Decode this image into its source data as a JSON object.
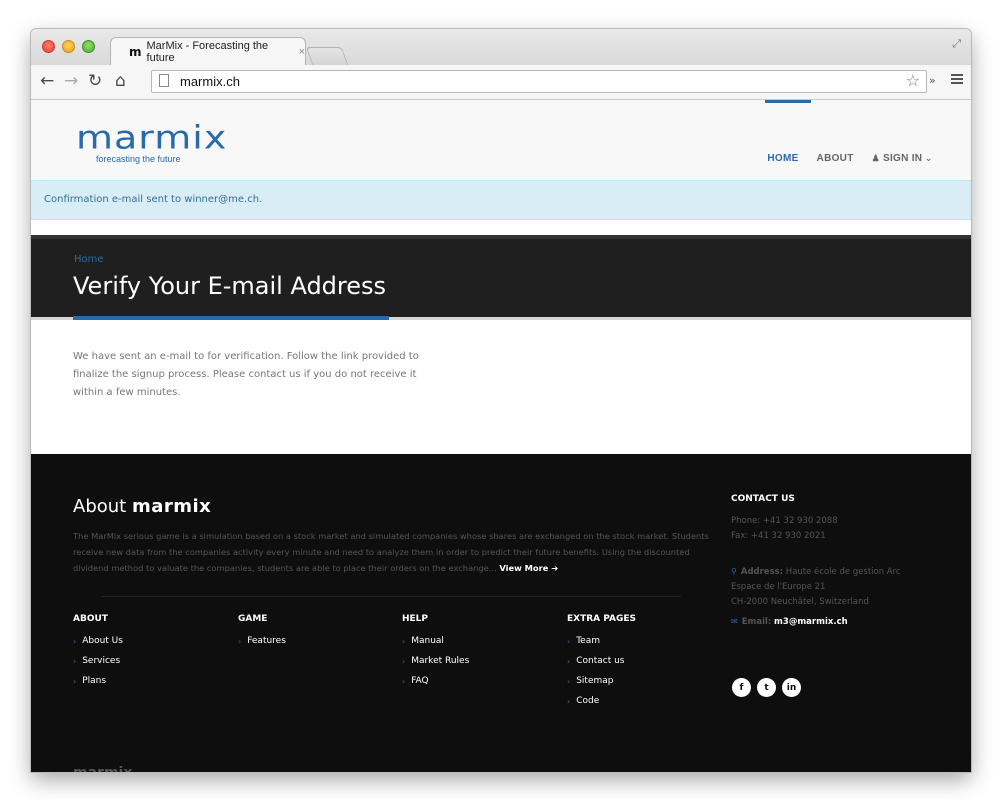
{
  "browser": {
    "tab_title": "MarMix - Forecasting the future",
    "tab_favicon": "m",
    "tab_close": "×",
    "url": "marmix.ch",
    "extensions_label": "»"
  },
  "header": {
    "logo_text": "marmix",
    "logo_tagline": "forecasting the future",
    "nav": {
      "home": "HOME",
      "about": "ABOUT",
      "signin": "SIGN IN",
      "signin_caret": "⌄"
    }
  },
  "alert": {
    "text": "Confirmation e-mail sent to winner@me.ch."
  },
  "title_bar": {
    "breadcrumb": "Home",
    "title": "Verify Your E-mail Address"
  },
  "content": {
    "message": "We have sent an e-mail to for verification. Follow the link provided to finalize the signup process. Please contact us if you do not receive it within a few minutes."
  },
  "footer": {
    "about_prefix": "About ",
    "about_brand": "marmix",
    "about_text": "The MarMix serious game is a simulation based on a stock market and simulated companies whose shares are exchanged on the stock market. Students receive new data from the companies activity every minute and need to analyze them in order to predict their future benefits. Using the discounted dividend method to valuate the companies, students are able to place their orders on the exchange...",
    "view_more": "View More ➔",
    "columns": [
      {
        "heading": "ABOUT",
        "links": [
          "About Us",
          "Services",
          "Plans"
        ]
      },
      {
        "heading": "GAME",
        "links": [
          "Features"
        ]
      },
      {
        "heading": "HELP",
        "links": [
          "Manual",
          "Market Rules",
          "FAQ"
        ]
      },
      {
        "heading": "EXTRA PAGES",
        "links": [
          "Team",
          "Contact us",
          "Sitemap",
          "Code"
        ]
      }
    ],
    "contact": {
      "heading": "CONTACT US",
      "phone": "Phone: +41 32 930 2088",
      "fax": "Fax: +41 32 930 2021",
      "address_label": "Address:",
      "address_line1": "Haute école de gestion Arc",
      "address_line2": "Espace de l'Europe 21",
      "address_line3": "CH-2000 Neuchâtel, Switzerland",
      "email_label": "Email:",
      "email": "m3@marmix.ch"
    },
    "socials": [
      "f",
      "t",
      "in"
    ],
    "bottom_logo": "marmix"
  },
  "colors": {
    "accent": "#2a6aa8",
    "alert_bg": "#d9edf7",
    "footer_bg": "#0e0e0e",
    "title_bar_bg": "#1f1f1f"
  }
}
